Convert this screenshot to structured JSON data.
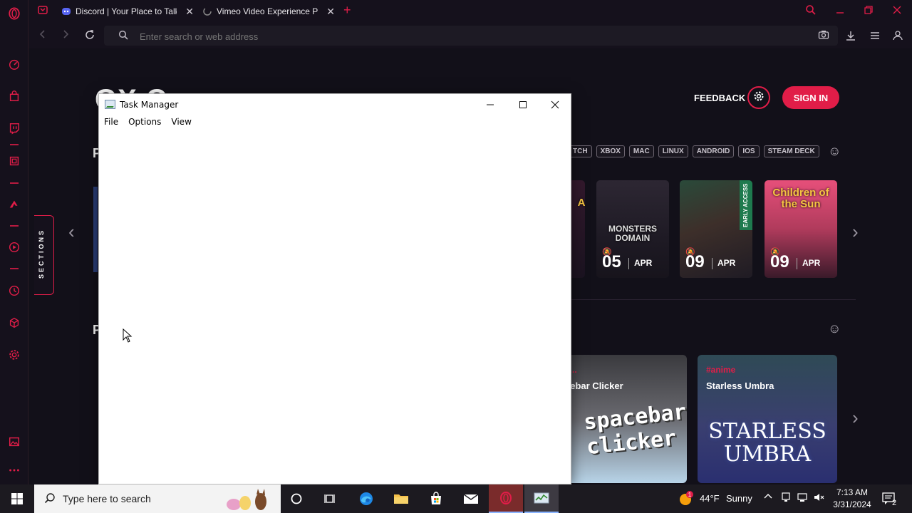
{
  "browser": {
    "tabs": [
      {
        "title": "Discord | Your Place to Talk",
        "favicon": "discord-icon"
      },
      {
        "title": "Vimeo Video Experience Pl",
        "favicon": "loading-spinner-icon"
      }
    ],
    "address_placeholder": "Enter search or web address"
  },
  "gx": {
    "title": "GX Corner",
    "feedback": "FEEDBACK",
    "sign_in": "SIGN IN",
    "sections_label": "SECTIONS",
    "row1_letter": "P",
    "row2_letter": "P",
    "platforms": [
      "TCH",
      "XBOX",
      "MAC",
      "LINUX",
      "ANDROID",
      "IOS",
      "STEAM DECK"
    ],
    "releases": [
      {
        "cover": "A",
        "day": "",
        "month": ""
      },
      {
        "cover": "MONSTERS DOMAIN",
        "day": "05",
        "month": "APR"
      },
      {
        "cover": "",
        "day": "09",
        "month": "APR",
        "badge": "EARLY ACCESS"
      },
      {
        "cover": "Children of the Sun",
        "day": "09",
        "month": "APR"
      }
    ],
    "games": [
      {
        "tag": "#...",
        "name": "cebar Clicker",
        "cover_text": "spacebar clicker"
      },
      {
        "tag": "#anime",
        "name": "Starless Umbra",
        "cover_text": "STARLESS UMBRA"
      }
    ]
  },
  "task_manager": {
    "title": "Task Manager",
    "menu": [
      "File",
      "Options",
      "View"
    ]
  },
  "taskbar": {
    "search_placeholder": "Type here to search",
    "weather_temp": "44°F",
    "weather_text": "Sunny",
    "time": "7:13 AM",
    "date": "3/31/2024",
    "notification_count": "2",
    "weather_badge": "1"
  },
  "colors": {
    "accent": "#e11d48",
    "background": "#121019",
    "taskbar": "#1c1a20"
  }
}
